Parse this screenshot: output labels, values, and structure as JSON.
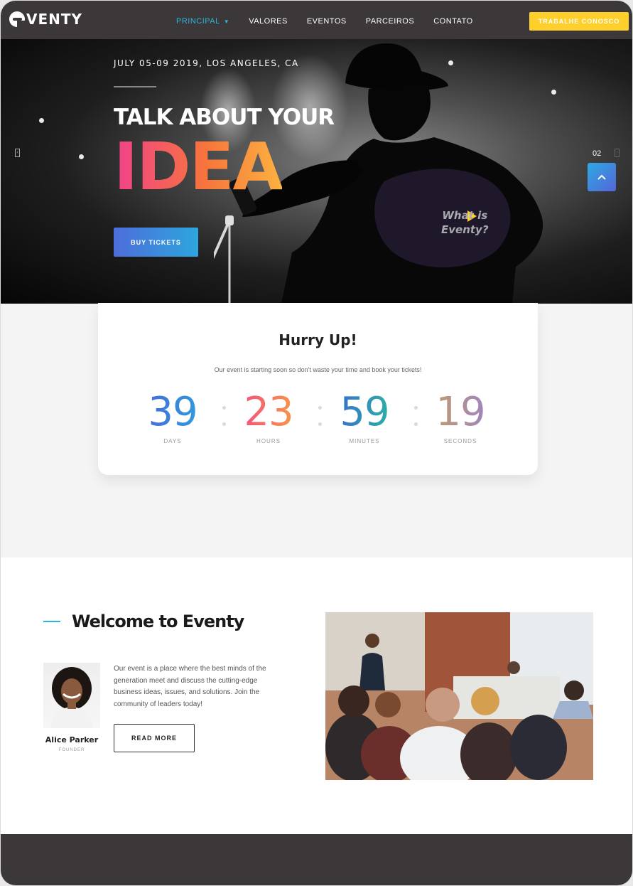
{
  "brand": {
    "name": "VENTY"
  },
  "nav": {
    "items": [
      {
        "label": "PRINCIPAL",
        "active": true
      },
      {
        "label": "VALORES"
      },
      {
        "label": "EVENTOS"
      },
      {
        "label": "PARCEIROS"
      },
      {
        "label": "CONTATO"
      }
    ],
    "cta_label": "TRABALHE CONOSCO"
  },
  "hero": {
    "date_location": "JULY 05-09 2019, LOS ANGELES, CA",
    "headline": "TALK ABOUT YOUR",
    "highlight": "IDEA",
    "button_label": "BUY TICKETS",
    "video_prompt_line1": "What is",
    "video_prompt_line2": "Eventy?",
    "slide_number": "02",
    "prev_icon": "chevron-left-icon",
    "next_icon": "chevron-right-icon"
  },
  "countdown": {
    "title": "Hurry Up!",
    "subtitle": "Our event is starting soon so don't waste your time and book your tickets!",
    "units": [
      {
        "value": "39",
        "label": "DAYS"
      },
      {
        "value": "23",
        "label": "HOURS"
      },
      {
        "value": "59",
        "label": "MINUTES"
      },
      {
        "value": "19",
        "label": "SECONDS"
      }
    ]
  },
  "welcome": {
    "title": "Welcome to Eventy",
    "text": "Our event is a place where the best minds of the generation meet and discuss the cutting-edge business ideas, issues, and solutions. Join the community of leaders today!",
    "button_label": "READ MORE",
    "founder": {
      "name": "Alice Parker",
      "role": "FOUNDER"
    }
  },
  "colors": {
    "nav_bg": "#3c3839",
    "accent_blue": "#2db4d8",
    "cta_yellow": "#ffd02c",
    "idea_gradient": [
      "#f0428b",
      "#f7753c",
      "#fbb240"
    ]
  }
}
